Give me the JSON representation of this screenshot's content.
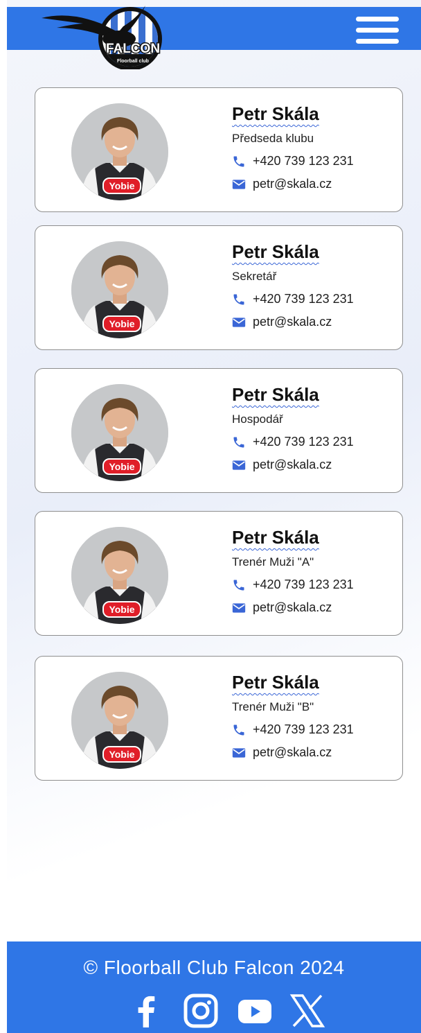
{
  "brand": {
    "logo_text": "FALCON",
    "logo_subtext": "Floorball club",
    "colors": {
      "primary": "#2f76e6",
      "card_border": "#8e8e8e",
      "icon": "#3a66d6"
    }
  },
  "header": {
    "menu_icon": "hamburger-menu-icon"
  },
  "contacts": [
    {
      "name": "Petr Skála",
      "role": "Předseda klubu",
      "phone": "+420 739 123 231",
      "email": "petr@skala.cz"
    },
    {
      "name": "Petr Skála",
      "role": "Sekretář",
      "phone": "+420 739 123 231",
      "email": "petr@skala.cz"
    },
    {
      "name": "Petr Skála",
      "role": "Hospodář",
      "phone": "+420 739 123 231",
      "email": "petr@skala.cz"
    },
    {
      "name": "Petr Skála",
      "role": "Trenér Muži \"A\"",
      "phone": "+420 739 123 231",
      "email": "petr@skala.cz"
    },
    {
      "name": "Petr Skála",
      "role": "Trenér Muži \"B\"",
      "phone": "+420 739 123 231",
      "email": "petr@skala.cz"
    }
  ],
  "jersey_sponsor": "Yobie",
  "footer": {
    "copyright": "© Floorball Club Falcon 2024",
    "social_icons": [
      "facebook-icon",
      "instagram-icon",
      "youtube-icon",
      "x-icon"
    ]
  }
}
